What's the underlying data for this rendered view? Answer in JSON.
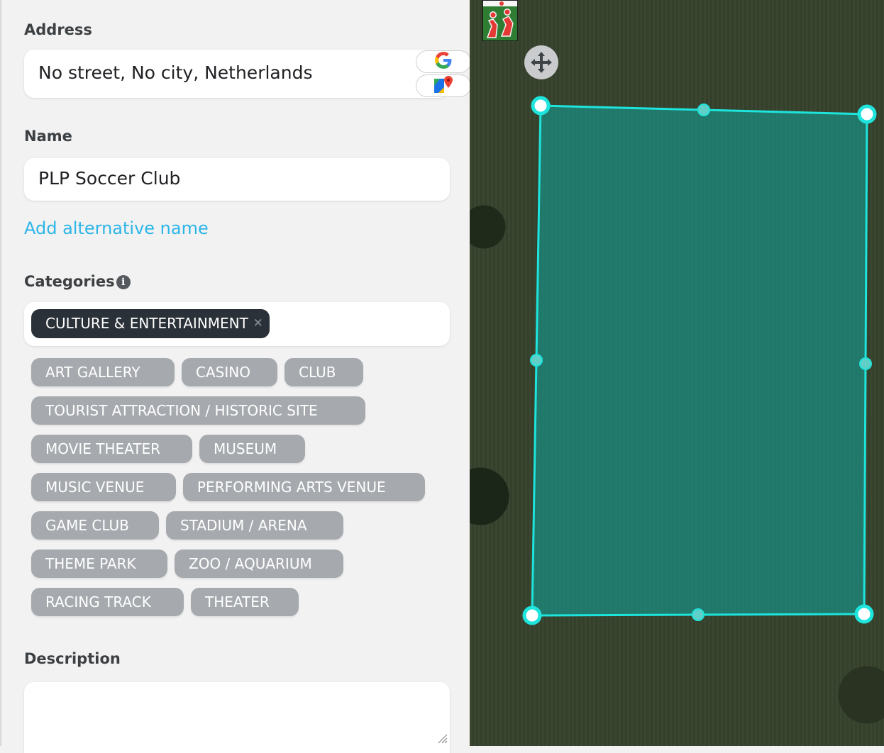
{
  "form": {
    "address": {
      "label": "Address",
      "value": "No street, No city, Netherlands"
    },
    "name": {
      "label": "Name",
      "value": "PLP Soccer Club"
    },
    "add_alt_name_label": "Add alternative name",
    "categories": {
      "label": "Categories",
      "selected": "CULTURE & ENTERTAINMENT",
      "options": [
        "ART GALLERY",
        "CASINO",
        "CLUB",
        "TOURIST ATTRACTION / HISTORIC SITE",
        "MOVIE THEATER",
        "MUSEUM",
        "MUSIC VENUE",
        "PERFORMING ARTS VENUE",
        "GAME CLUB",
        "STADIUM / ARENA",
        "THEME PARK",
        "ZOO / AQUARIUM",
        "RACING TRACK",
        "THEATER"
      ]
    },
    "description": {
      "label": "Description",
      "value": ""
    }
  },
  "icons": {
    "google_search": "google-g-icon",
    "google_maps": "google-maps-icon",
    "info": "info-icon",
    "remove_chip": "close-icon",
    "move": "move-arrows-icon",
    "place_marker": "soccer-players-icon"
  },
  "colors": {
    "link": "#2cb5e8",
    "selected_chip": "#2a3138",
    "category_chip": "#a6aaae",
    "polygon": "#1de4dc"
  }
}
